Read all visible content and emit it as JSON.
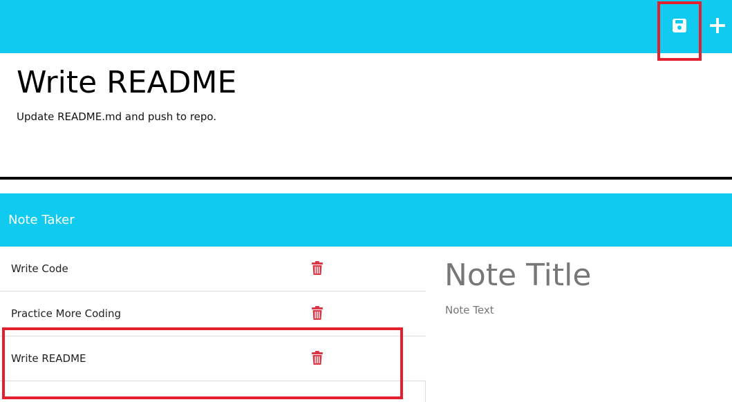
{
  "toolbar": {
    "save_icon": "floppy-disk-icon",
    "new_icon": "plus-icon",
    "accent_color": "#10cbef"
  },
  "active_note": {
    "title": "Write README",
    "text": "Update README.md and push to repo."
  },
  "navbar": {
    "brand": "Note Taker"
  },
  "notes": [
    {
      "label": "Write Code",
      "delete_icon": "trash-icon"
    },
    {
      "label": "Practice More Coding",
      "delete_icon": "trash-icon"
    },
    {
      "label": "Write README",
      "delete_icon": "trash-icon"
    }
  ],
  "editor": {
    "title_placeholder": "Note Title",
    "text_placeholder": "Note Text"
  },
  "colors": {
    "delete": "#dc3545",
    "highlight": "#e5202e"
  }
}
